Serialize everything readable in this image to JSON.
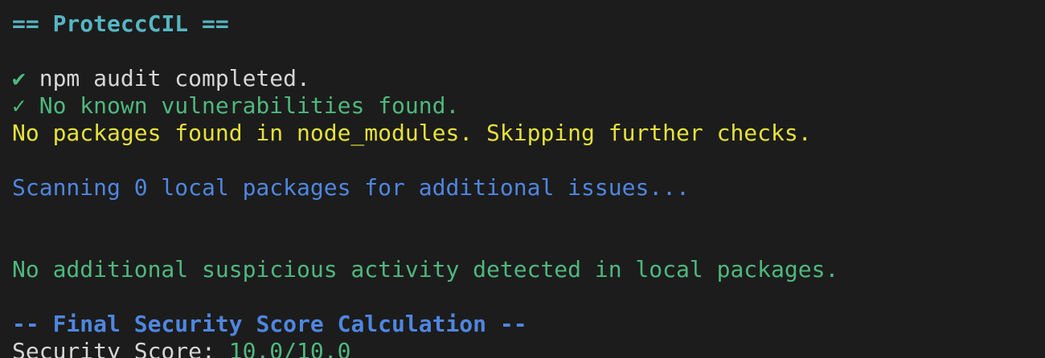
{
  "terminal": {
    "header": {
      "prefix": "== ",
      "title": "ProteccCIL",
      "suffix": " =="
    },
    "audit_done": {
      "check": "✔",
      "text": " npm audit completed."
    },
    "no_vulns": {
      "check": "✓",
      "text": " No known vulnerabilities found."
    },
    "no_packages": "No packages found in node_modules. Skipping further checks.",
    "scanning": "Scanning 0 local packages for additional issues...",
    "no_suspicious": "No additional suspicious activity detected in local packages.",
    "final_section": {
      "prefix": "-- ",
      "title": "Final Security Score Calculation",
      "suffix": " --"
    },
    "score": {
      "label": "Security Score: ",
      "value": "10.0/10.0"
    }
  },
  "colors": {
    "background": "#1c1c1c",
    "cyan": "#56b6c2",
    "white": "#d6d6d6",
    "green": "#4fb87e",
    "yellow": "#e5e23c",
    "blue": "#4f86e0"
  }
}
